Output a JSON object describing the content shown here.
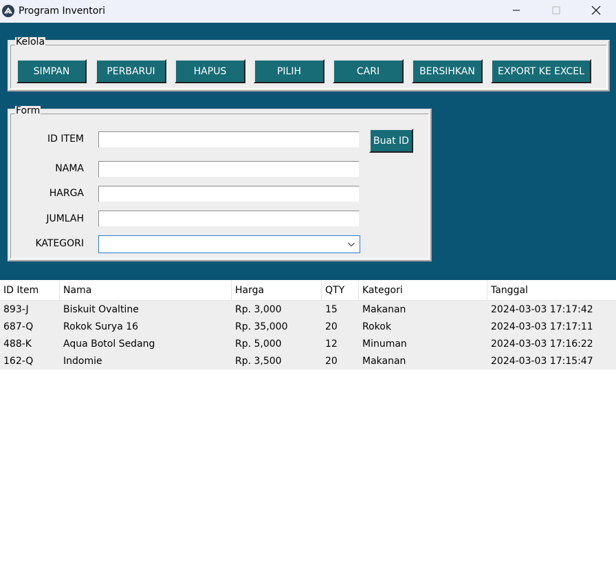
{
  "window": {
    "title": "Program Inventori"
  },
  "kelola": {
    "label": "Kelola",
    "buttons": {
      "simpan": "SIMPAN",
      "perbarui": "PERBARUI",
      "hapus": "HAPUS",
      "pilih": "PILIH",
      "cari": "CARI",
      "bersihkan": "BERSIHKAN",
      "export": "EXPORT KE EXCEL"
    }
  },
  "form": {
    "label": "Form",
    "fields": {
      "id_item": {
        "label": "ID ITEM",
        "value": ""
      },
      "nama": {
        "label": "NAMA",
        "value": ""
      },
      "harga": {
        "label": "HARGA",
        "value": ""
      },
      "jumlah": {
        "label": "JUMLAH",
        "value": ""
      },
      "kategori": {
        "label": "KATEGORI",
        "value": ""
      }
    },
    "buat_id_label": "Buat ID"
  },
  "table": {
    "columns": [
      "ID Item",
      "Nama",
      "Harga",
      "QTY",
      "Kategori",
      "Tanggal"
    ],
    "rows": [
      [
        "893-J",
        "Biskuit Ovaltine",
        "Rp. 3,000",
        "15",
        "Makanan",
        "2024-03-03 17:17:42"
      ],
      [
        "687-Q",
        "Rokok Surya 16",
        "Rp. 35,000",
        "20",
        "Rokok",
        "2024-03-03 17:17:11"
      ],
      [
        "488-K",
        "Aqua Botol Sedang",
        "Rp. 5,000",
        "12",
        "Minuman",
        "2024-03-03 17:16:22"
      ],
      [
        "162-Q",
        "Indomie",
        "Rp. 3,500",
        "20",
        "Makanan",
        "2024-03-03 17:15:47"
      ]
    ]
  },
  "colors": {
    "background": "#0b5574",
    "button": "#176c76",
    "panel": "#eeeeee",
    "focus": "#2a7ad6"
  },
  "icons": {
    "app": "app-logo-icon",
    "minimize": "minimize-icon",
    "maximize": "maximize-icon",
    "close": "close-icon",
    "dropdown": "chevron-down-icon"
  }
}
